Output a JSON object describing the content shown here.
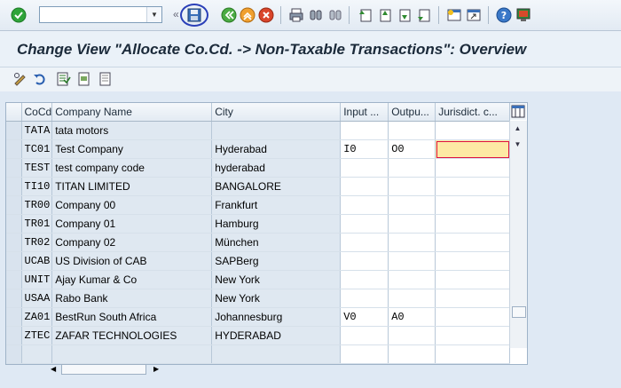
{
  "toolbar": {
    "command_field_value": "",
    "icons": [
      "enter-icon",
      "save-icon",
      "back-icon",
      "exit-icon",
      "cancel-icon",
      "print-icon",
      "find-icon",
      "find-next-icon",
      "first-page-icon",
      "previous-page-icon",
      "next-page-icon",
      "last-page-icon",
      "new-session-icon",
      "shortcut-icon",
      "help-icon",
      "customize-layout-icon"
    ]
  },
  "title": "Change View \"Allocate Co.Cd. -> Non-Taxable Transactions\": Overview",
  "app_toolbar": {
    "icons": [
      "change-display-icon",
      "undo-icon",
      "select-all-icon",
      "select-block-icon",
      "deselect-all-icon"
    ]
  },
  "table": {
    "columns": [
      "CoCd",
      "Company Name",
      "City",
      "Input ...",
      "Outpu...",
      "Jurisdict. c..."
    ],
    "rows": [
      {
        "cocd": "TATA",
        "name": "tata motors",
        "city": "",
        "input": "",
        "output": "",
        "jurisdiction": ""
      },
      {
        "cocd": "TC01",
        "name": "Test Company",
        "city": "Hyderabad",
        "input": "I0",
        "output": "O0",
        "jurisdiction": ""
      },
      {
        "cocd": "TEST",
        "name": "test company code",
        "city": "hyderabad",
        "input": "",
        "output": "",
        "jurisdiction": ""
      },
      {
        "cocd": "TI10",
        "name": "TITAN LIMITED",
        "city": "BANGALORE",
        "input": "",
        "output": "",
        "jurisdiction": ""
      },
      {
        "cocd": "TR00",
        "name": "Company 00",
        "city": "Frankfurt",
        "input": "",
        "output": "",
        "jurisdiction": ""
      },
      {
        "cocd": "TR01",
        "name": "Company 01",
        "city": "Hamburg",
        "input": "",
        "output": "",
        "jurisdiction": ""
      },
      {
        "cocd": "TR02",
        "name": "Company 02",
        "city": "München",
        "input": "",
        "output": "",
        "jurisdiction": ""
      },
      {
        "cocd": "UCAB",
        "name": "US Division of CAB",
        "city": "SAPBerg",
        "input": "",
        "output": "",
        "jurisdiction": ""
      },
      {
        "cocd": "UNIT",
        "name": "Ajay Kumar & Co",
        "city": "New York",
        "input": "",
        "output": "",
        "jurisdiction": ""
      },
      {
        "cocd": "USAA",
        "name": "Rabo Bank",
        "city": "New York",
        "input": "",
        "output": "",
        "jurisdiction": ""
      },
      {
        "cocd": "ZA01",
        "name": "BestRun South Africa",
        "city": "Johannesburg",
        "input": "V0",
        "output": "A0",
        "jurisdiction": ""
      },
      {
        "cocd": "ZTEC",
        "name": "ZAFAR TECHNOLOGIES",
        "city": "HYDERABAD",
        "input": "",
        "output": "",
        "jurisdiction": ""
      },
      {
        "cocd": "",
        "name": "",
        "city": "",
        "input": "",
        "output": "",
        "jurisdiction": ""
      }
    ]
  },
  "colors": {
    "background": "#dfe9f4",
    "readonly_cell": "#dfe8f1",
    "focus_cell": "#fde9a4",
    "save_highlight_circle": "#2a3fb8"
  }
}
